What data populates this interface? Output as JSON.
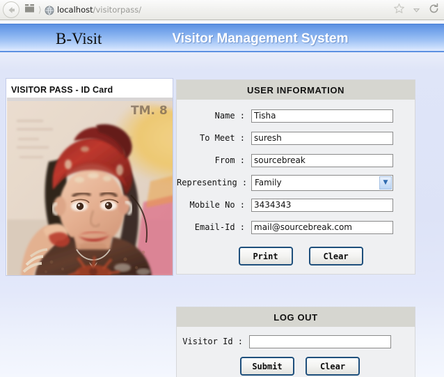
{
  "browser": {
    "back_icon": "back-arrow-icon",
    "stack_icon": "tab-stack-icon",
    "favicon": "globe-favicon",
    "url_host": "localhost",
    "url_path": "/visitorpass/",
    "bookmark_icon": "star-icon",
    "dropdown_icon": "chevron-down-icon",
    "reload_icon": "reload-icon"
  },
  "banner": {
    "brand": "B-Visit",
    "title": "Visitor Management System",
    "gradient_top": "#5a8fe0",
    "gradient_bottom": "#dfeaff"
  },
  "idcard": {
    "title": "VISITOR PASS - ID Card",
    "photo_name": "visitor-photo",
    "photo_caption_text": "TM. 8"
  },
  "user_information": {
    "heading": "USER INFORMATION",
    "fields": [
      {
        "label": "Name :",
        "value": "Tisha",
        "type": "text",
        "name": "name"
      },
      {
        "label": "To Meet :",
        "value": "suresh",
        "type": "text",
        "name": "to-meet"
      },
      {
        "label": "From :",
        "value": "sourcebreak",
        "type": "text",
        "name": "from"
      },
      {
        "label": "Representing :",
        "value": "Family",
        "type": "select",
        "name": "representing"
      },
      {
        "label": "Mobile No :",
        "value": "3434343",
        "type": "text",
        "name": "mobile-no"
      },
      {
        "label": "Email-Id :",
        "value": "mail@sourcebreak.com",
        "type": "text",
        "name": "email-id"
      }
    ],
    "representing_options": [
      "Family"
    ],
    "buttons": {
      "print": "Print",
      "clear": "Clear"
    }
  },
  "log_out": {
    "heading": "LOG OUT",
    "visitor_id_label": "Visitor Id :",
    "visitor_id_value": "",
    "buttons": {
      "submit": "Submit",
      "clear": "Clear"
    }
  },
  "colors": {
    "panel_head_bg": "#d6d6d0",
    "panel_bg": "#eff0f2",
    "button_border": "#1e4f7c",
    "page_bg": "#dde3f7"
  }
}
